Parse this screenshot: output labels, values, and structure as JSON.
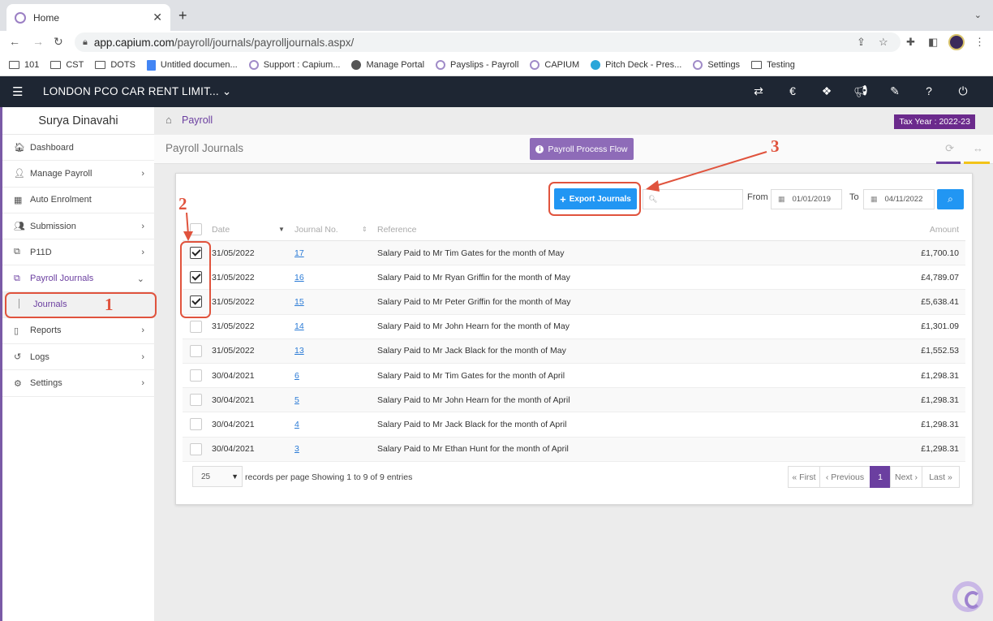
{
  "browser": {
    "tab_title": "Home",
    "url_domain": "app.capium.com",
    "url_path": "/payroll/journals/payrolljournals.aspx/",
    "bookmarks": [
      {
        "label": "101",
        "icon": "folder-icon"
      },
      {
        "label": "CST",
        "icon": "folder-icon"
      },
      {
        "label": "DOTS",
        "icon": "folder-icon"
      },
      {
        "label": "Untitled documen...",
        "icon": "doc-icon"
      },
      {
        "label": "Support : Capium...",
        "icon": "capium-icon"
      },
      {
        "label": "Manage Portal",
        "icon": "globe-icon"
      },
      {
        "label": "Payslips - Payroll",
        "icon": "capium-icon"
      },
      {
        "label": "CAPIUM",
        "icon": "capium-icon"
      },
      {
        "label": "Pitch Deck - Pres...",
        "icon": "pitch-icon"
      },
      {
        "label": "Settings",
        "icon": "capium-icon"
      },
      {
        "label": "Testing",
        "icon": "folder-icon"
      }
    ]
  },
  "header": {
    "company": "LONDON PCO CAR RENT LIMIT...",
    "icons": [
      "switch-icon",
      "capium-icon",
      "apps-icon",
      "megaphone-icon",
      "ticket-icon",
      "help-icon",
      "power-icon"
    ]
  },
  "sidebar": {
    "user": "Surya Dinavahi",
    "items": [
      {
        "label": "Dashboard",
        "icon": "dashboard-icon",
        "arrow": ""
      },
      {
        "label": "Manage Payroll",
        "icon": "user-icon",
        "arrow": "›"
      },
      {
        "label": "Auto Enrolment",
        "icon": "grid-icon",
        "arrow": ""
      },
      {
        "label": "Submission",
        "icon": "users-icon",
        "arrow": "›"
      },
      {
        "label": "P11D",
        "icon": "copy-icon",
        "arrow": "›"
      },
      {
        "label": "Payroll Journals",
        "icon": "copy-icon",
        "arrow": "⌄"
      },
      {
        "label": "Reports",
        "icon": "report-icon",
        "arrow": "›"
      },
      {
        "label": "Logs",
        "icon": "history-icon",
        "arrow": "›"
      },
      {
        "label": "Settings",
        "icon": "gear-icon",
        "arrow": "›"
      }
    ],
    "sub_item": "Journals"
  },
  "page": {
    "breadcrumb": "Payroll",
    "tax_year": "Tax Year : 2022-23",
    "title": "Payroll Journals",
    "flow_button": "Payroll Process Flow"
  },
  "filters": {
    "export_label": "Export Journals",
    "search_placeholder": "",
    "from_label": "From",
    "from_date": "01/01/2019",
    "to_label": "To",
    "to_date": "04/11/2022"
  },
  "table": {
    "headers": {
      "date": "Date",
      "journal_no": "Journal No.",
      "reference": "Reference",
      "amount": "Amount"
    },
    "rows": [
      {
        "checked": true,
        "date": "31/05/2022",
        "journal_no": "17",
        "reference": "Salary Paid to Mr Tim Gates for the month of May",
        "amount": "£1,700.10"
      },
      {
        "checked": true,
        "date": "31/05/2022",
        "journal_no": "16",
        "reference": "Salary Paid to Mr Ryan Griffin for the month of May",
        "amount": "£4,789.07"
      },
      {
        "checked": true,
        "date": "31/05/2022",
        "journal_no": "15",
        "reference": "Salary Paid to Mr Peter Griffin for the month of May",
        "amount": "£5,638.41"
      },
      {
        "checked": false,
        "date": "31/05/2022",
        "journal_no": "14",
        "reference": "Salary Paid to Mr John Hearn for the month of May",
        "amount": "£1,301.09"
      },
      {
        "checked": false,
        "date": "31/05/2022",
        "journal_no": "13",
        "reference": "Salary Paid to Mr Jack Black for the month of May",
        "amount": "£1,552.53"
      },
      {
        "checked": false,
        "date": "30/04/2021",
        "journal_no": "6",
        "reference": "Salary Paid to Mr Tim Gates for the month of April",
        "amount": "£1,298.31"
      },
      {
        "checked": false,
        "date": "30/04/2021",
        "journal_no": "5",
        "reference": "Salary Paid to Mr John Hearn for the month of April",
        "amount": "£1,298.31"
      },
      {
        "checked": false,
        "date": "30/04/2021",
        "journal_no": "4",
        "reference": "Salary Paid to Mr Jack Black for the month of April",
        "amount": "£1,298.31"
      },
      {
        "checked": false,
        "date": "30/04/2021",
        "journal_no": "3",
        "reference": "Salary Paid to Mr Ethan Hunt for the month of April",
        "amount": "£1,298.31"
      }
    ]
  },
  "footer": {
    "page_size": "25",
    "records_label": "records per page",
    "showing": "Showing 1 to 9 of 9 entries",
    "pager": {
      "first": "« First",
      "prev": "‹ Previous",
      "current": "1",
      "next": "Next ›",
      "last": "Last »"
    }
  },
  "annotations": {
    "one": "1",
    "two": "2",
    "three": "3"
  },
  "colors": {
    "accent": "#6b3fa0",
    "primary_button": "#2196f3",
    "annotation": "#e0533d",
    "header_bg": "#1e2633"
  }
}
